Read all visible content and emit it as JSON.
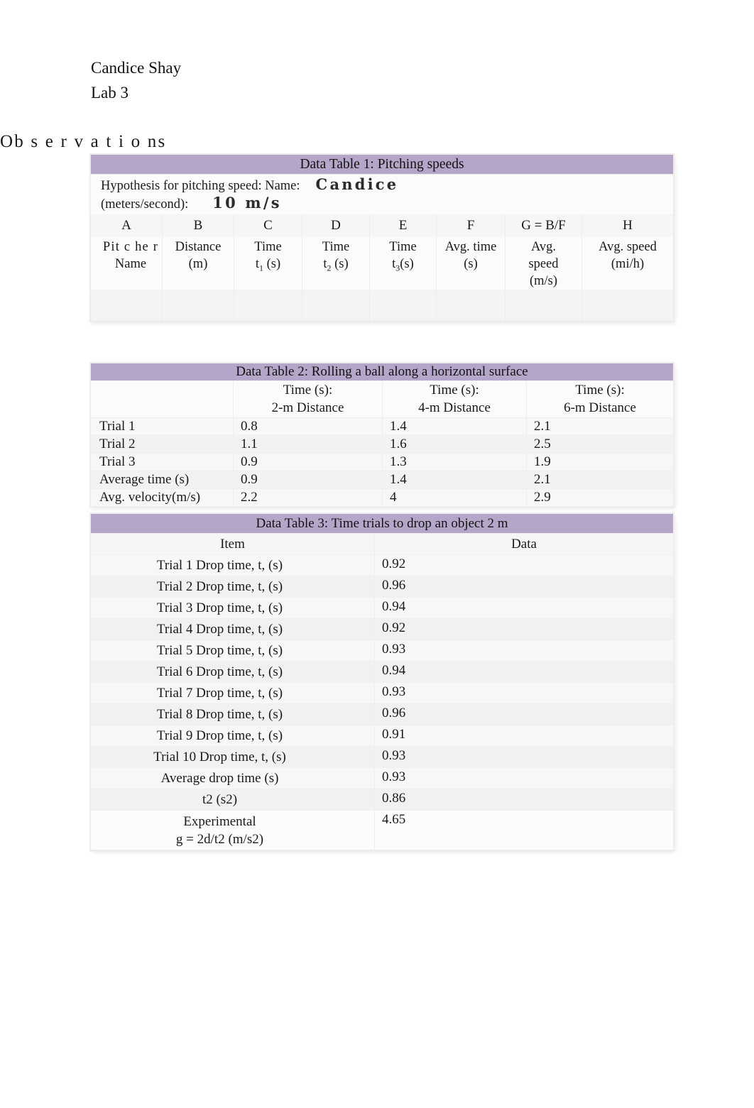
{
  "header": {
    "author": "Candice Shay",
    "lab": "Lab 3"
  },
  "section": {
    "title": "Ob s e r v a t i o ns"
  },
  "colors": {
    "band": "#b5a6c9",
    "page": "#ffffff",
    "cell": "#f7f7f7"
  },
  "table1": {
    "caption": "Data Table 1:  Pitching speeds",
    "hypothesis_label_line1": "Hypothesis for pitching speed: Name:",
    "hypothesis_label_line2": "(meters/second):",
    "name_value": "Candice",
    "speed_value": "10 m/s",
    "letters": [
      "A",
      "B",
      "C",
      "D",
      "E",
      "F",
      "G = B/F",
      "H"
    ],
    "headers": [
      {
        "line1": "Pit c he r",
        "line2": "Name",
        "sub": ""
      },
      {
        "line1": "Distance",
        "line2": "(m)",
        "sub": ""
      },
      {
        "line1": "Time",
        "line2": "t",
        "sub": "1",
        "tail": " (s)"
      },
      {
        "line1": "Time",
        "line2": "t",
        "sub": "2",
        "tail": " (s)"
      },
      {
        "line1": "Time",
        "line2": "t",
        "sub": "3",
        "tail": "(s)"
      },
      {
        "line1": "Avg. time",
        "line2": "(s)",
        "sub": ""
      },
      {
        "line1": "Avg.",
        "line2": "speed",
        "line3": "(m/s)",
        "sub": ""
      },
      {
        "line1": "Avg. speed",
        "line2": "(mi/h)",
        "sub": ""
      }
    ],
    "data_row": [
      "",
      "",
      "",
      "",
      "",
      "",
      "",
      ""
    ]
  },
  "table2": {
    "caption": "Data Table 2:  Rolling a ball along a horizontal surface",
    "col_headers": [
      {
        "line1": "",
        "line2": ""
      },
      {
        "line1": "Time (s):",
        "line2": "2-m Distance"
      },
      {
        "line1": "Time (s):",
        "line2": "4-m Distance"
      },
      {
        "line1": "Time (s):",
        "line2": "6-m Distance"
      }
    ],
    "rows": [
      {
        "label": "Trial 1",
        "values": [
          "0.8",
          "1.4",
          "2.1"
        ]
      },
      {
        "label": "Trial 2",
        "values": [
          "1.1",
          "1.6",
          "2.5"
        ]
      },
      {
        "label": "Trial 3",
        "values": [
          "0.9",
          "1.3",
          "1.9"
        ]
      },
      {
        "label": "Average time (s)",
        "values": [
          "0.9",
          "1.4",
          "2.1"
        ]
      },
      {
        "label": "Avg. velocity(m/s)",
        "values": [
          "2.2",
          "4",
          "2.9"
        ]
      }
    ]
  },
  "table3": {
    "caption": "Data Table 3:  Time trials to drop an object 2 m",
    "col_headers": [
      "Item",
      "Data"
    ],
    "rows": [
      {
        "label": "Trial 1 Drop time, t, (s)",
        "value": "0.92"
      },
      {
        "label": "Trial 2 Drop time, t, (s)",
        "value": "0.96"
      },
      {
        "label": "Trial 3 Drop time, t, (s)",
        "value": "0.94"
      },
      {
        "label": "Trial 4 Drop time, t, (s)",
        "value": "0.92"
      },
      {
        "label": "Trial 5 Drop time, t, (s)",
        "value": "0.93"
      },
      {
        "label": "Trial 6 Drop time, t, (s)",
        "value": "0.94"
      },
      {
        "label": "Trial 7 Drop time, t, (s)",
        "value": "0.93"
      },
      {
        "label": "Trial 8 Drop time, t, (s)",
        "value": "0.96"
      },
      {
        "label": "Trial 9 Drop time, t, (s)",
        "value": "0.91"
      },
      {
        "label": "Trial 10 Drop time, t, (s)",
        "value": "0.93"
      },
      {
        "label": "Average drop time (s)",
        "value": "0.93"
      },
      {
        "label": "t2 (s2)",
        "value": "0.86"
      }
    ],
    "last_row": {
      "label_line1": "Experimental",
      "label_line2": "g = 2d/t2 (m/s2)",
      "value": "4.65"
    }
  }
}
